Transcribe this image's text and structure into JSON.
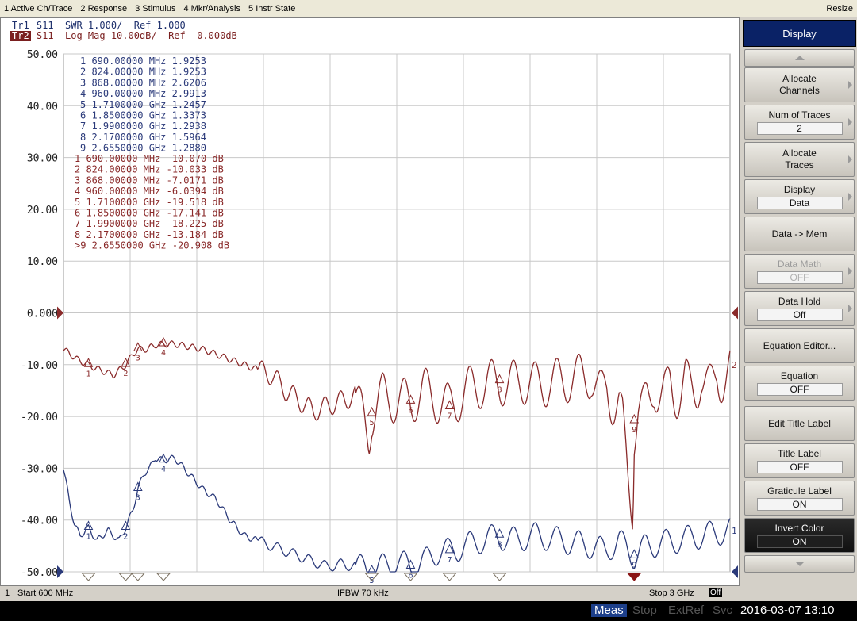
{
  "menu": {
    "items": [
      "1 Active Ch/Trace",
      "2 Response",
      "3 Stimulus",
      "4 Mkr/Analysis",
      "5 Instr State"
    ],
    "resize": "Resize"
  },
  "traces": {
    "tr1": {
      "badge": "Tr1",
      "text": " S11  SWR 1.000/  Ref 1.000"
    },
    "tr2": {
      "badge": "Tr2",
      "text": " S11  Log Mag 10.00dB/  Ref  0.000dB"
    }
  },
  "chart_data": {
    "type": "line",
    "ylim": [
      -50,
      50
    ],
    "xlim_mhz": [
      600,
      3000
    ],
    "y_tick_labels": [
      "50.00",
      "40.00",
      "30.00",
      "20.00",
      "10.00",
      "0.000",
      "-10.00",
      "-20.00",
      "-30.00",
      "-40.00",
      "-50.00"
    ],
    "y_ticks": [
      50,
      40,
      30,
      20,
      10,
      0,
      -10,
      -20,
      -30,
      -40,
      -50
    ],
    "grid": true,
    "reference_level_db": 0,
    "series": [
      {
        "name": "Tr1",
        "color": "#2b3a7a",
        "x": [
          600,
          620,
          640,
          660,
          690,
          720,
          760,
          800,
          824,
          850,
          868,
          890,
          910,
          930,
          960,
          1000,
          1050,
          1100,
          1150,
          1200,
          1250,
          1300,
          1350,
          1400,
          1450,
          1500,
          1550,
          1600,
          1650,
          1700,
          1710,
          1750,
          1800,
          1850,
          1900,
          1950,
          1990,
          2050,
          2100,
          2170,
          2200,
          2300,
          2400,
          2500,
          2550,
          2600,
          2655,
          2700,
          2800,
          2900,
          3000
        ],
        "y": [
          -30,
          -36,
          -41,
          -43,
          -41.5,
          -44,
          -42,
          -44,
          -41.5,
          -38,
          -34,
          -31,
          -30,
          -28,
          -28.5,
          -28,
          -31,
          -34,
          -36,
          -40,
          -43,
          -44,
          -45,
          -46,
          -47,
          -48,
          -49,
          -48.5,
          -49,
          -49.5,
          -50,
          -49,
          -48,
          -49,
          -48,
          -46,
          -46,
          -45,
          -44,
          -43,
          -44,
          -43,
          -44,
          -45,
          -46,
          -44,
          -47,
          -45,
          -44,
          -43,
          -42
        ],
        "marker_display_values": [
          1.9253,
          1.9253,
          2.6206,
          2.9913,
          1.2457,
          1.3373,
          1.2938,
          1.5964,
          1.288
        ]
      },
      {
        "name": "Tr2",
        "color": "#8a2a2a",
        "x": [
          600,
          650,
          690,
          730,
          780,
          824,
          850,
          868,
          900,
          930,
          960,
          1000,
          1050,
          1100,
          1150,
          1200,
          1250,
          1300,
          1350,
          1400,
          1450,
          1500,
          1550,
          1600,
          1650,
          1700,
          1710,
          1750,
          1800,
          1850,
          1900,
          1950,
          1990,
          2050,
          2100,
          2170,
          2200,
          2250,
          2300,
          2400,
          2500,
          2550,
          2600,
          2650,
          2655,
          2700,
          2800,
          2900,
          3000
        ],
        "y": [
          -7,
          -9,
          -10.07,
          -11,
          -12,
          -10.03,
          -8,
          -7.02,
          -7,
          -6.2,
          -6.04,
          -6,
          -6.5,
          -7,
          -8,
          -9,
          -10,
          -11,
          -12,
          -15,
          -17,
          -19,
          -18,
          -17,
          -16,
          -24,
          -19.52,
          -16,
          -17,
          -17.14,
          -15,
          -17,
          -18.23,
          -15,
          -14,
          -13.18,
          -14,
          -13,
          -14,
          -13,
          -12,
          -13,
          -16,
          -35,
          -20.91,
          -14,
          -13,
          -12,
          -10
        ]
      }
    ],
    "markers": [
      {
        "id": "1",
        "freq": "690.00000 MHz",
        "tr1": "1.9253",
        "tr2": "-10.070 dB",
        "mhz": 690
      },
      {
        "id": "2",
        "freq": "824.00000 MHz",
        "tr1": "1.9253",
        "tr2": "-10.033 dB",
        "mhz": 824
      },
      {
        "id": "3",
        "freq": "868.00000 MHz",
        "tr1": "2.6206",
        "tr2": "-7.0171 dB",
        "mhz": 868
      },
      {
        "id": "4",
        "freq": "960.00000 MHz",
        "tr1": "2.9913",
        "tr2": "-6.0394 dB",
        "mhz": 960
      },
      {
        "id": "5",
        "freq": "1.7100000 GHz",
        "tr1": "1.2457",
        "tr2": "-19.518 dB",
        "mhz": 1710
      },
      {
        "id": "6",
        "freq": "1.8500000 GHz",
        "tr1": "1.3373",
        "tr2": "-17.141 dB",
        "mhz": 1850
      },
      {
        "id": "7",
        "freq": "1.9900000 GHz",
        "tr1": "1.2938",
        "tr2": "-18.225 dB",
        "mhz": 1990
      },
      {
        "id": "8",
        "freq": "2.1700000 GHz",
        "tr1": "1.5964",
        "tr2": "-13.184 dB",
        "mhz": 2170
      },
      {
        "id": "9",
        "freq": "2.6550000 GHz",
        "tr1": "1.2880",
        "tr2": "-20.908 dB",
        "mhz": 2655,
        "active_prefix": ">"
      }
    ],
    "trace_end_labels": [
      "2",
      "1"
    ]
  },
  "softkeys": {
    "title": "Display",
    "allocate_channels": "Allocate\nChannels",
    "num_traces_label": "Num of Traces",
    "num_traces_value": "2",
    "allocate_traces": "Allocate\nTraces",
    "display_label": "Display",
    "display_value": "Data",
    "data_mem": "Data -> Mem",
    "data_math_label": "Data Math",
    "data_math_value": "OFF",
    "data_hold_label": "Data Hold",
    "data_hold_value": "Off",
    "equation_editor": "Equation Editor...",
    "equation_label": "Equation",
    "equation_value": "OFF",
    "edit_title_label": "Edit Title Label",
    "title_label_label": "Title Label",
    "title_label_value": "OFF",
    "graticule_label_label": "Graticule Label",
    "graticule_label_value": "ON",
    "invert_color_label": "Invert Color",
    "invert_color_value": "ON"
  },
  "infobar": {
    "channel": "1",
    "start": "Start 600 MHz",
    "ifbw": "IFBW 70 kHz",
    "stop": "Stop 3 GHz",
    "off": "Off"
  },
  "statusbar": {
    "meas": "Meas",
    "stop": "Stop",
    "extref": "ExtRef",
    "svc": "Svc",
    "datetime": "2016-03-07 13:10"
  },
  "colors": {
    "tr1": "#2b3a7a",
    "tr2": "#8a2a2a",
    "grid": "#c8c8c8",
    "softkey_title_bg": "#0a2266"
  }
}
